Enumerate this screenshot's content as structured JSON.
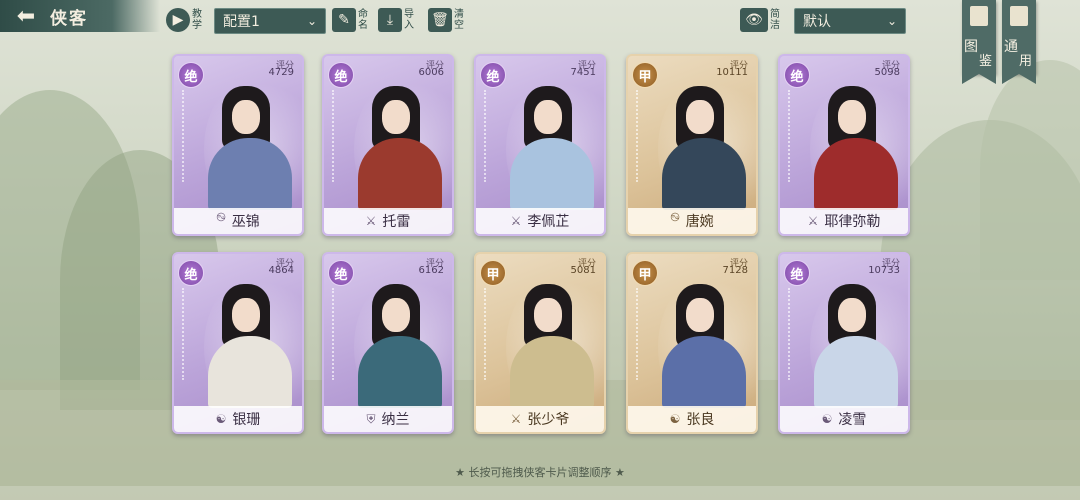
{
  "header": {
    "title": "侠客",
    "back_icon": "arrow-left",
    "tutorial_label": "教学",
    "config_value": "配置1",
    "rename_label": "命名",
    "import_label": "导入",
    "clear_label": "清空",
    "filter_label": "简洁",
    "sort_value": "默认",
    "atlas_label_1": "图",
    "atlas_label_2": "鉴",
    "general_label_1": "通",
    "general_label_2": "用"
  },
  "cards": [
    {
      "grade": "绝",
      "score_label": "评分",
      "score": "4729",
      "name": "巫锦",
      "faction_icon": "swirl-icon",
      "outfit": "#6d7fb0"
    },
    {
      "grade": "绝",
      "score_label": "评分",
      "score": "6006",
      "name": "托雷",
      "faction_icon": "sword-icon",
      "outfit": "#9b3a2e"
    },
    {
      "grade": "绝",
      "score_label": "评分",
      "score": "7451",
      "name": "李佩芷",
      "faction_icon": "sword-icon",
      "outfit": "#a9c3df"
    },
    {
      "grade": "甲",
      "score_label": "评分",
      "score": "10111",
      "name": "唐婉",
      "faction_icon": "swirl-icon",
      "outfit": "#34475a"
    },
    {
      "grade": "绝",
      "score_label": "评分",
      "score": "5098",
      "name": "耶律弥勒",
      "faction_icon": "sword-icon",
      "outfit": "#9e2c2c"
    },
    {
      "grade": "绝",
      "score_label": "评分",
      "score": "4864",
      "name": "银珊",
      "faction_icon": "yinyang-icon",
      "outfit": "#e8e4dc"
    },
    {
      "grade": "绝",
      "score_label": "评分",
      "score": "6162",
      "name": "纳兰",
      "faction_icon": "shield-icon",
      "outfit": "#3b6a7a"
    },
    {
      "grade": "甲",
      "score_label": "评分",
      "score": "5081",
      "name": "张少爷",
      "faction_icon": "sword-icon",
      "outfit": "#cdbd8f"
    },
    {
      "grade": "甲",
      "score_label": "评分",
      "score": "7128",
      "name": "张良",
      "faction_icon": "yinyang-icon",
      "outfit": "#5b6fa8"
    },
    {
      "grade": "绝",
      "score_label": "评分",
      "score": "10733",
      "name": "凌雪",
      "faction_icon": "yinyang-icon",
      "outfit": "#c9d6e8"
    }
  ],
  "footer": {
    "hint": "★ 长按可拖拽侠客卡片调整顺序 ★"
  }
}
